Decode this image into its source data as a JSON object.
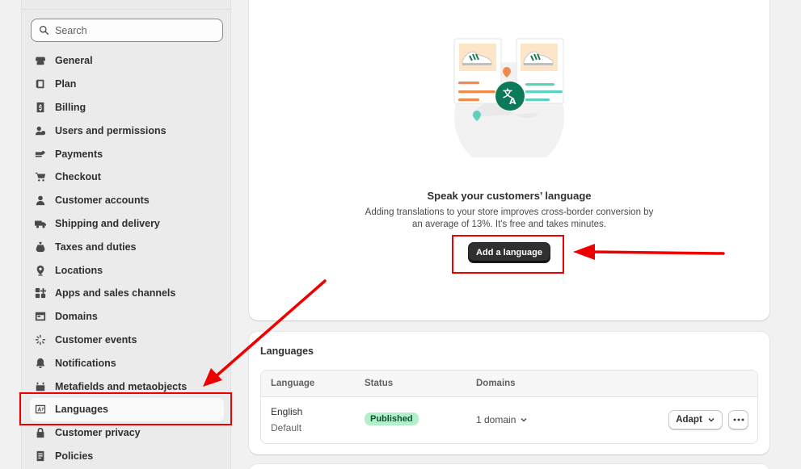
{
  "search": {
    "placeholder": "Search"
  },
  "sidebar": {
    "items": [
      {
        "label": "General",
        "icon": "store-icon"
      },
      {
        "label": "Plan",
        "icon": "plan-icon"
      },
      {
        "label": "Billing",
        "icon": "billing-icon"
      },
      {
        "label": "Users and permissions",
        "icon": "users-icon"
      },
      {
        "label": "Payments",
        "icon": "payments-icon"
      },
      {
        "label": "Checkout",
        "icon": "cart-icon"
      },
      {
        "label": "Customer accounts",
        "icon": "person-icon"
      },
      {
        "label": "Shipping and delivery",
        "icon": "truck-icon"
      },
      {
        "label": "Taxes and duties",
        "icon": "taxes-icon"
      },
      {
        "label": "Locations",
        "icon": "location-icon"
      },
      {
        "label": "Apps and sales channels",
        "icon": "apps-icon"
      },
      {
        "label": "Domains",
        "icon": "domains-icon"
      },
      {
        "label": "Customer events",
        "icon": "sparkle-icon"
      },
      {
        "label": "Notifications",
        "icon": "bell-icon"
      },
      {
        "label": "Metafields and metaobjects",
        "icon": "metafields-icon"
      },
      {
        "label": "Languages",
        "icon": "language-icon"
      },
      {
        "label": "Customer privacy",
        "icon": "lock-icon"
      },
      {
        "label": "Policies",
        "icon": "policies-icon"
      }
    ],
    "active": "Languages"
  },
  "hero": {
    "title": "Speak your customers’ language",
    "description": "Adding translations to your store improves cross-border conversion by an average of 13%. It's free and takes minutes.",
    "button": "Add a language"
  },
  "languages": {
    "heading": "Languages",
    "columns": [
      "Language",
      "Status",
      "Domains"
    ],
    "rows": [
      {
        "language": "English",
        "sub": "Default",
        "status": "Published",
        "domains": "1 domain",
        "action": "Adapt"
      }
    ]
  },
  "colors": {
    "annotation": "#e00000",
    "badge_bg": "#b3f0c9",
    "primary_btn": "#303030",
    "accent_green": "#0b7a5a"
  }
}
